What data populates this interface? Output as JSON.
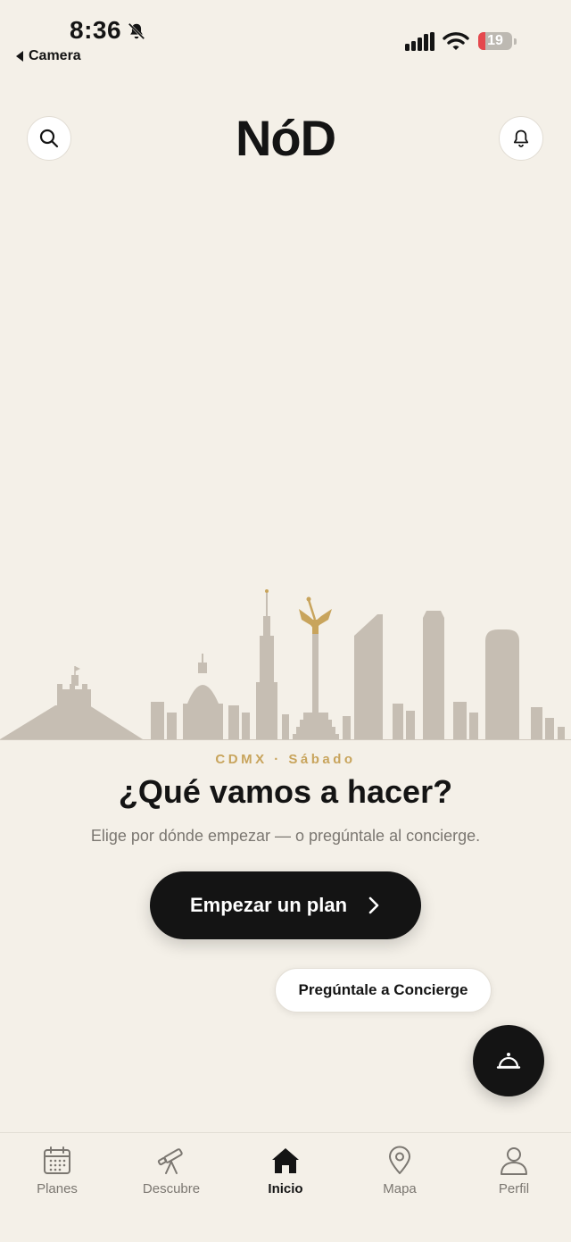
{
  "status_bar": {
    "time": "8:36",
    "back_label": "Camera",
    "battery": "19"
  },
  "header": {
    "logo": "NóD"
  },
  "hero": {
    "kicker": "CDMX · Sábado",
    "headline": "¿Qué vamos a hacer?",
    "subtitle": "Elige por dónde empezar — o pregúntale al concierge."
  },
  "actions": {
    "primary_label": "Empezar un plan",
    "concierge_label": "Pregúntale a Concierge"
  },
  "tabs": [
    {
      "label": "Planes",
      "icon": "calendar-icon"
    },
    {
      "label": "Descubre",
      "icon": "telescope-icon"
    },
    {
      "label": "Inicio",
      "icon": "home-icon",
      "active": true
    },
    {
      "label": "Mapa",
      "icon": "map-pin-icon"
    },
    {
      "label": "Perfil",
      "icon": "person-icon"
    }
  ],
  "colors": {
    "background": "#f4f0e8",
    "accent_gold": "#c8a45c",
    "dark": "#141414",
    "skyline": "#c6beb3",
    "muted_text": "#7b7771"
  }
}
